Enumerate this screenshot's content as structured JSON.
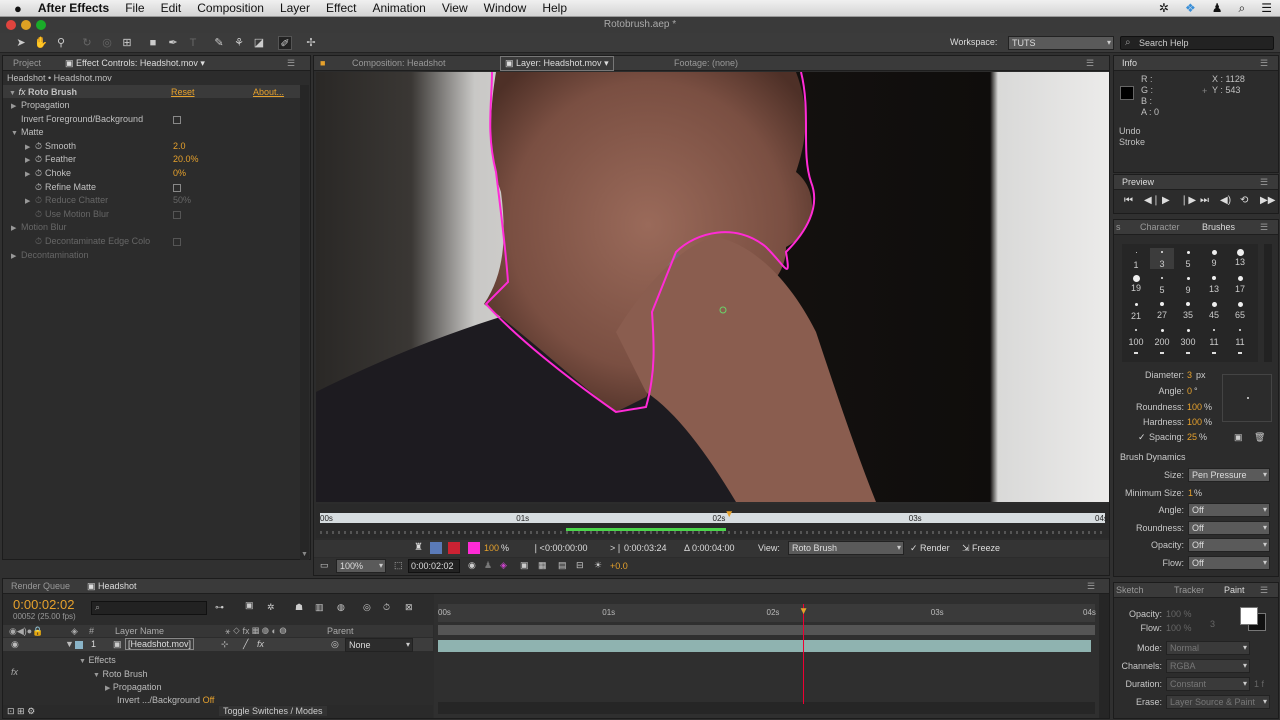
{
  "menubar": {
    "app": "After Effects",
    "items": [
      "File",
      "Edit",
      "Composition",
      "Layer",
      "Effect",
      "Animation",
      "View",
      "Window",
      "Help"
    ]
  },
  "window_title": "Rotobrush.aep *",
  "workspace": {
    "label": "Workspace:",
    "value": "TUTS"
  },
  "search": {
    "placeholder": "Search Help"
  },
  "left_tabs": {
    "project": "Project",
    "effect_controls": "Effect Controls: Headshot.mov"
  },
  "effect_controls": {
    "breadcrumb": "Headshot • Headshot.mov",
    "effect_name": "Roto Brush",
    "reset": "Reset",
    "about": "About...",
    "rows": [
      {
        "label": "Propagation",
        "indent": 1,
        "arrow": "▶"
      },
      {
        "label": "Invert Foreground/Background",
        "indent": 1,
        "check": true
      },
      {
        "label": "Matte",
        "indent": 1,
        "arrow": "▼"
      },
      {
        "label": "Smooth",
        "indent": 2,
        "arrow": "▶",
        "stopwatch": true,
        "value": "2.0"
      },
      {
        "label": "Feather",
        "indent": 2,
        "arrow": "▶",
        "stopwatch": true,
        "value": "20.0%"
      },
      {
        "label": "Choke",
        "indent": 2,
        "arrow": "▶",
        "stopwatch": true,
        "value": "0%"
      },
      {
        "label": "Refine Matte",
        "indent": 2,
        "stopwatch": true,
        "check": true
      },
      {
        "label": "Reduce Chatter",
        "indent": 2,
        "arrow": "▶",
        "stopwatch": true,
        "value": "50%",
        "dim": true
      },
      {
        "label": "Use Motion Blur",
        "indent": 2,
        "stopwatch": true,
        "check": true,
        "dim": true
      },
      {
        "label": "Motion Blur",
        "indent": 1,
        "arrow": "▶",
        "dim": true
      },
      {
        "label": "Decontaminate Edge Colo",
        "indent": 2,
        "stopwatch": true,
        "check": true,
        "dim": true
      },
      {
        "label": "Decontamination",
        "indent": 1,
        "arrow": "▶",
        "dim": true
      }
    ]
  },
  "viewer_tabs": {
    "composition": "Composition: Headshot",
    "layer": "Layer: Headshot.mov",
    "footage": "Footage: (none)"
  },
  "layer_timeline": {
    "ticks": [
      "00s",
      "01s",
      "02s",
      "03s",
      "04s"
    ],
    "current_fraction": 0.52
  },
  "viewer_controls": {
    "zoom_pct": "100",
    "pct": "%",
    "in": "0:00:00:00",
    "out": "0:00:03:24",
    "duration": "Δ 0:00:04:00",
    "view_label": "View:",
    "view_value": "Roto Brush",
    "render": "Render",
    "freeze": "Freeze"
  },
  "viewer_bottom": {
    "zoom": "100%",
    "timecode": "0:00:02:02",
    "exposure": "+0.0"
  },
  "info": {
    "tab": "Info",
    "r": "R :",
    "g": "G :",
    "b": "B :",
    "a": "A : 0",
    "x": "X : 1128",
    "y": "Y : 543",
    "undo": "Undo",
    "stroke": "Stroke"
  },
  "preview": {
    "tab": "Preview"
  },
  "brushes": {
    "tab_character": "Character",
    "tab_brushes": "Brushes",
    "sizes": [
      "1",
      "3",
      "5",
      "9",
      "13",
      "19",
      "5",
      "9",
      "13",
      "17",
      "21",
      "27",
      "35",
      "45",
      "65",
      "100",
      "200",
      "300",
      "11",
      "11"
    ],
    "diameter_label": "Diameter:",
    "diameter": "3",
    "diameter_unit": "px",
    "angle_label": "Angle:",
    "angle": "0",
    "angle_unit": "°",
    "roundness_label": "Roundness:",
    "roundness": "100",
    "roundness_unit": "%",
    "hardness_label": "Hardness:",
    "hardness": "100",
    "hardness_unit": "%",
    "spacing_label": "Spacing:",
    "spacing": "25",
    "spacing_unit": "%",
    "dynamics_title": "Brush Dynamics",
    "dyn": [
      {
        "label": "Size:",
        "value": "Pen Pressure"
      },
      {
        "label": "Minimum Size:",
        "value": "1",
        "unit": "%"
      },
      {
        "label": "Angle:",
        "value": "Off"
      },
      {
        "label": "Roundness:",
        "value": "Off"
      },
      {
        "label": "Opacity:",
        "value": "Off"
      },
      {
        "label": "Flow:",
        "value": "Off"
      }
    ]
  },
  "paint": {
    "tab_sketch": "Sketch",
    "tab_tracker": "Tracker",
    "tab_paint": "Paint",
    "opacity_label": "Opacity:",
    "opacity": "100 %",
    "flow_label": "Flow:",
    "flow": "100 %",
    "mode_label": "Mode:",
    "mode": "Normal",
    "channels_label": "Channels:",
    "channels": "RGBA",
    "duration_label": "Duration:",
    "duration": "Constant",
    "duration_frames": "1 f",
    "erase_label": "Erase:",
    "erase": "Layer Source & Paint",
    "num3": "3"
  },
  "timeline": {
    "tab_render": "Render Queue",
    "tab_headshot": "Headshot",
    "timecode": "0:00:02:02",
    "fps": "00052 (25.00 fps)",
    "col_layer": "Layer Name",
    "col_parent": "Parent",
    "col_hash": "#",
    "layer_num": "1",
    "layer_name": "[Headshot.mov]",
    "parent": "None",
    "effects": "Effects",
    "roto": "Roto Brush",
    "propagation": "Propagation",
    "invert": "Invert .../Background",
    "invert_val": "Off",
    "toggle": "Toggle Switches / Modes",
    "ticks": [
      "00s",
      "01s",
      "02s",
      "03s",
      "04s"
    ],
    "current_fraction": 0.555
  }
}
